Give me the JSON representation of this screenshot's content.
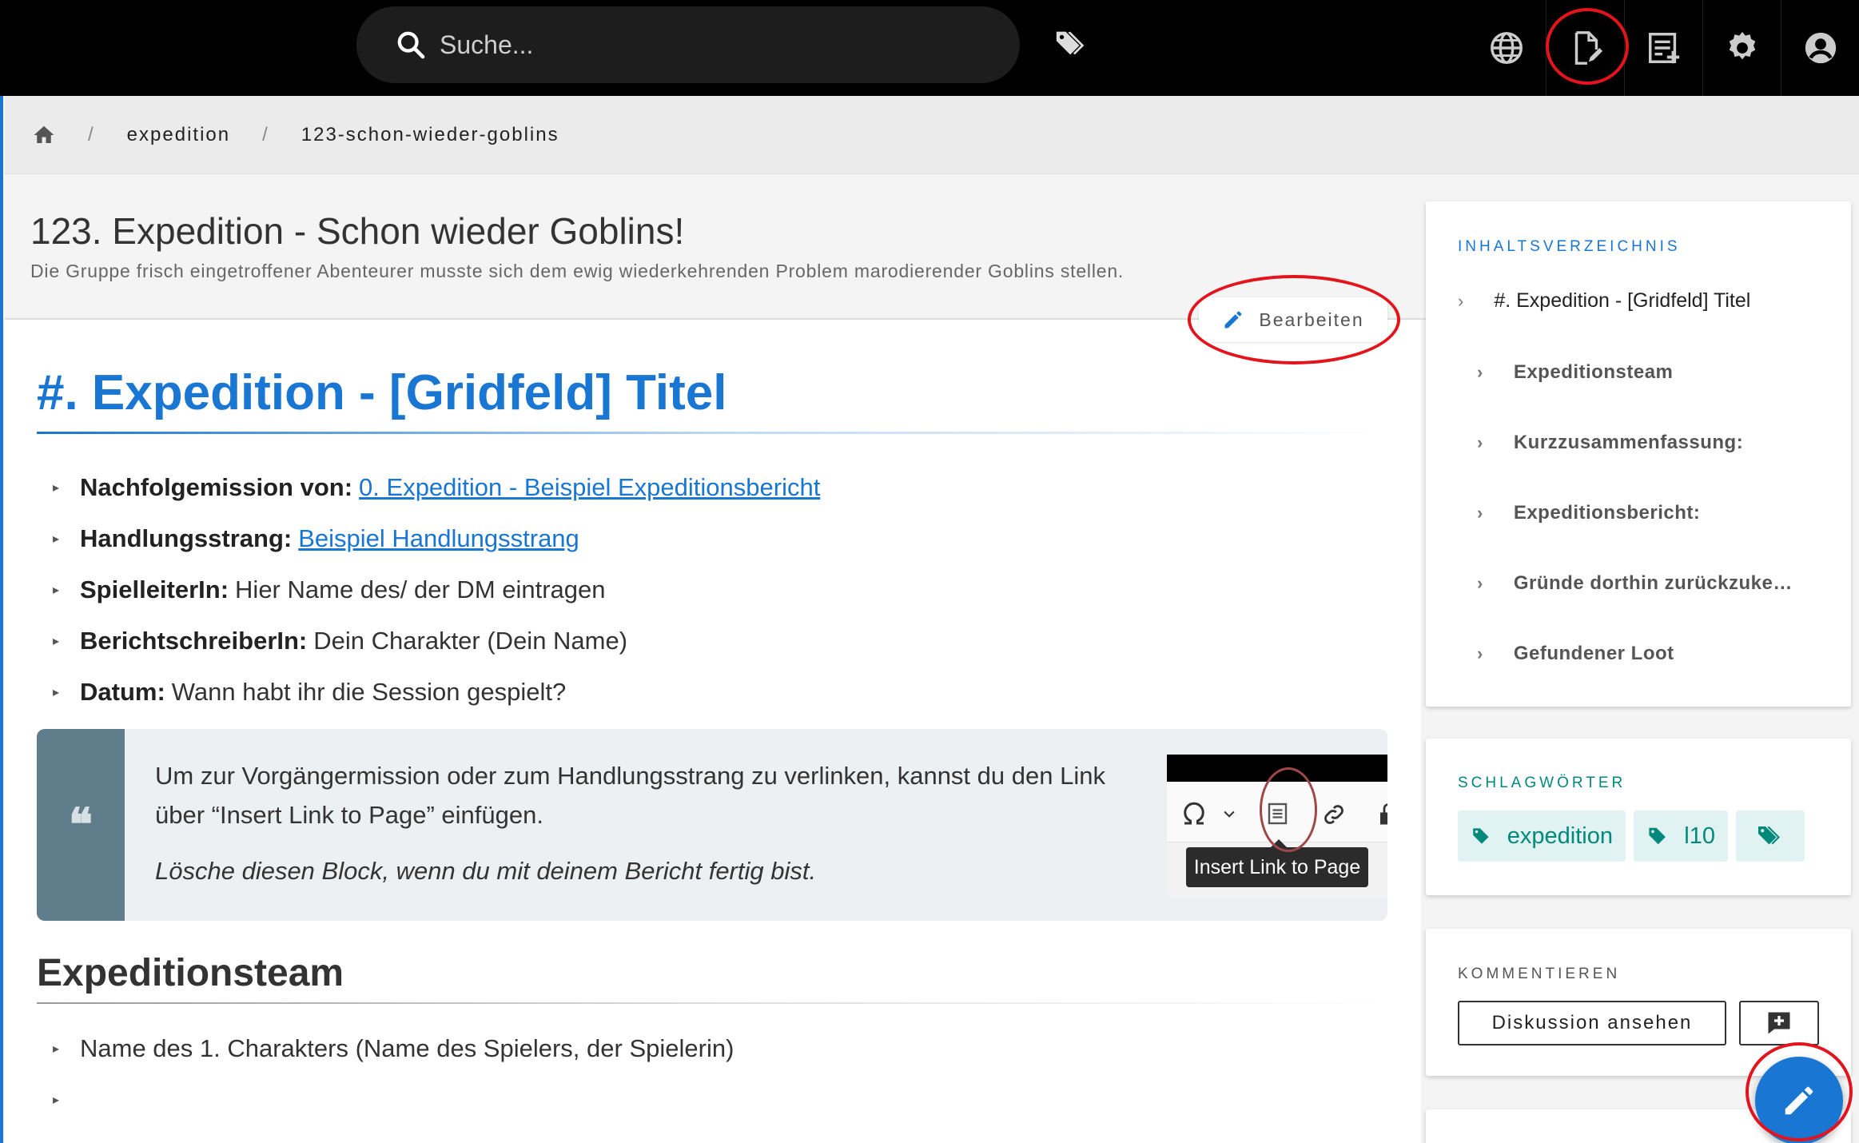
{
  "search": {
    "placeholder": "Suche..."
  },
  "breadcrumb": {
    "items": [
      "expedition",
      "123-schon-wieder-goblins"
    ]
  },
  "page": {
    "title": "123. Expedition - Schon wieder Goblins!",
    "description": "Die Gruppe frisch eingetroffener Abenteurer musste sich dem ewig wiederkehrenden Problem marodierender Goblins stellen.",
    "edit_label": "Bearbeiten"
  },
  "content": {
    "h1": "#. Expedition - [Gridfeld] Titel",
    "meta": [
      {
        "label": "Nachfolgemission von:",
        "link": "0. Expedition - Beispiel Expeditionsbericht"
      },
      {
        "label": "Handlungsstrang:",
        "link": "Beispiel Handlungsstrang"
      },
      {
        "label": "SpielleiterIn:",
        "text": "Hier Name des/ der DM eintragen"
      },
      {
        "label": "BerichtschreiberIn:",
        "text": "Dein Charakter (Dein Name)"
      },
      {
        "label": "Datum:",
        "text": "Wann habt ihr die Session gespielt?"
      }
    ],
    "quote": {
      "mark": "❝",
      "text": "Um zur Vorgängermission oder zum Handlungsstrang zu verlinken, kannst du den Link über “Insert Link to Page” einfügen.",
      "italic": "Lösche diesen Block, wenn du mit deinem Bericht fertig bist.",
      "tooltip": "Insert Link to Page"
    },
    "h2": "Expeditionsteam",
    "team": [
      "Name des 1. Charakters (Name des Spielers, der Spielerin)",
      ""
    ]
  },
  "sidebar": {
    "toc": {
      "label": "INHALTSVERZEICHNIS",
      "main": "#. Expedition - [Gridfeld] Titel",
      "items": [
        "Expeditionsteam",
        "Kurzzusammenfassung:",
        "Expeditionsbericht:",
        "Gründe dorthin zurückzuke…",
        "Gefundener Loot"
      ]
    },
    "tags": {
      "label": "SCHLAGWÖRTER",
      "items": [
        "expedition",
        "l10"
      ]
    },
    "comment": {
      "label": "KOMMENTIEREN",
      "discuss_label": "Diskussion ansehen"
    }
  },
  "colors": {
    "accent": "#1976d2",
    "teal": "#00897b",
    "highlight": "#e3141b"
  },
  "icons": [
    "search-icon",
    "tags-icon",
    "globe-icon",
    "new-page-icon",
    "page-actions-icon",
    "gear-icon",
    "account-icon",
    "home-icon",
    "pencil-icon",
    "tag-icon",
    "comment-plus-icon"
  ]
}
